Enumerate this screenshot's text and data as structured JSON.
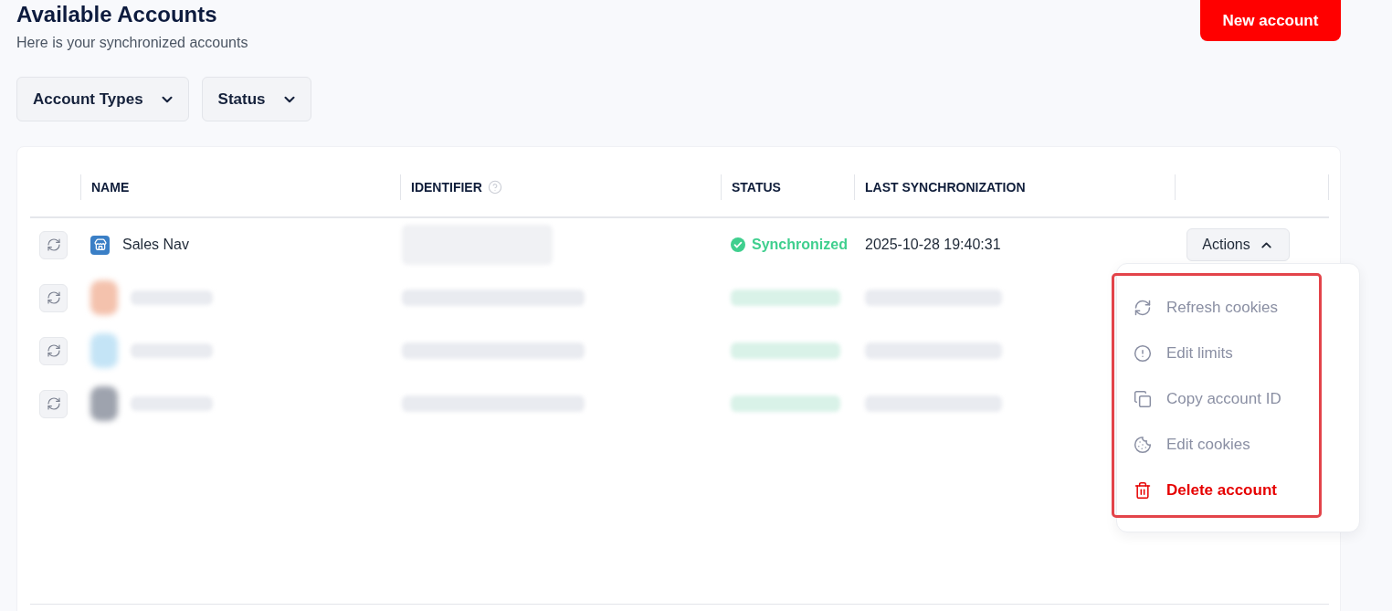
{
  "header": {
    "title": "Available Accounts",
    "subtitle": "Here is your synchronized accounts",
    "new_button": "New account"
  },
  "filters": [
    {
      "label": "Account Types",
      "expanded": false
    },
    {
      "label": "Status",
      "expanded": false
    }
  ],
  "table": {
    "columns": [
      {
        "label": "NAME",
        "help": false
      },
      {
        "label": "IDENTIFIER",
        "help": true
      },
      {
        "label": "STATUS",
        "help": false
      },
      {
        "label": "LAST SYNCHRONIZATION",
        "help": false
      }
    ],
    "rows": [
      {
        "redacted": false,
        "name": "Sales Nav",
        "identifier": {
          "redacted": true
        },
        "status": {
          "label": "Synchronized",
          "kind": "success"
        },
        "last_synchronization": "2025-10-28 19:40:31",
        "actions": {
          "label": "Actions",
          "expanded": true,
          "menu": {
            "highlighted": true,
            "items": [
              {
                "label": "Refresh cookies",
                "kind": "default"
              },
              {
                "label": "Edit limits",
                "kind": "default"
              },
              {
                "label": "Copy account ID",
                "kind": "default"
              },
              {
                "label": "Edit cookies",
                "kind": "default"
              },
              {
                "label": "Delete account",
                "kind": "danger"
              }
            ]
          }
        }
      },
      {
        "redacted": true,
        "color": "#f4c2ad"
      },
      {
        "redacted": true,
        "color": "#c4e4f6"
      },
      {
        "redacted": true,
        "color": "#9ea3ae"
      }
    ]
  }
}
